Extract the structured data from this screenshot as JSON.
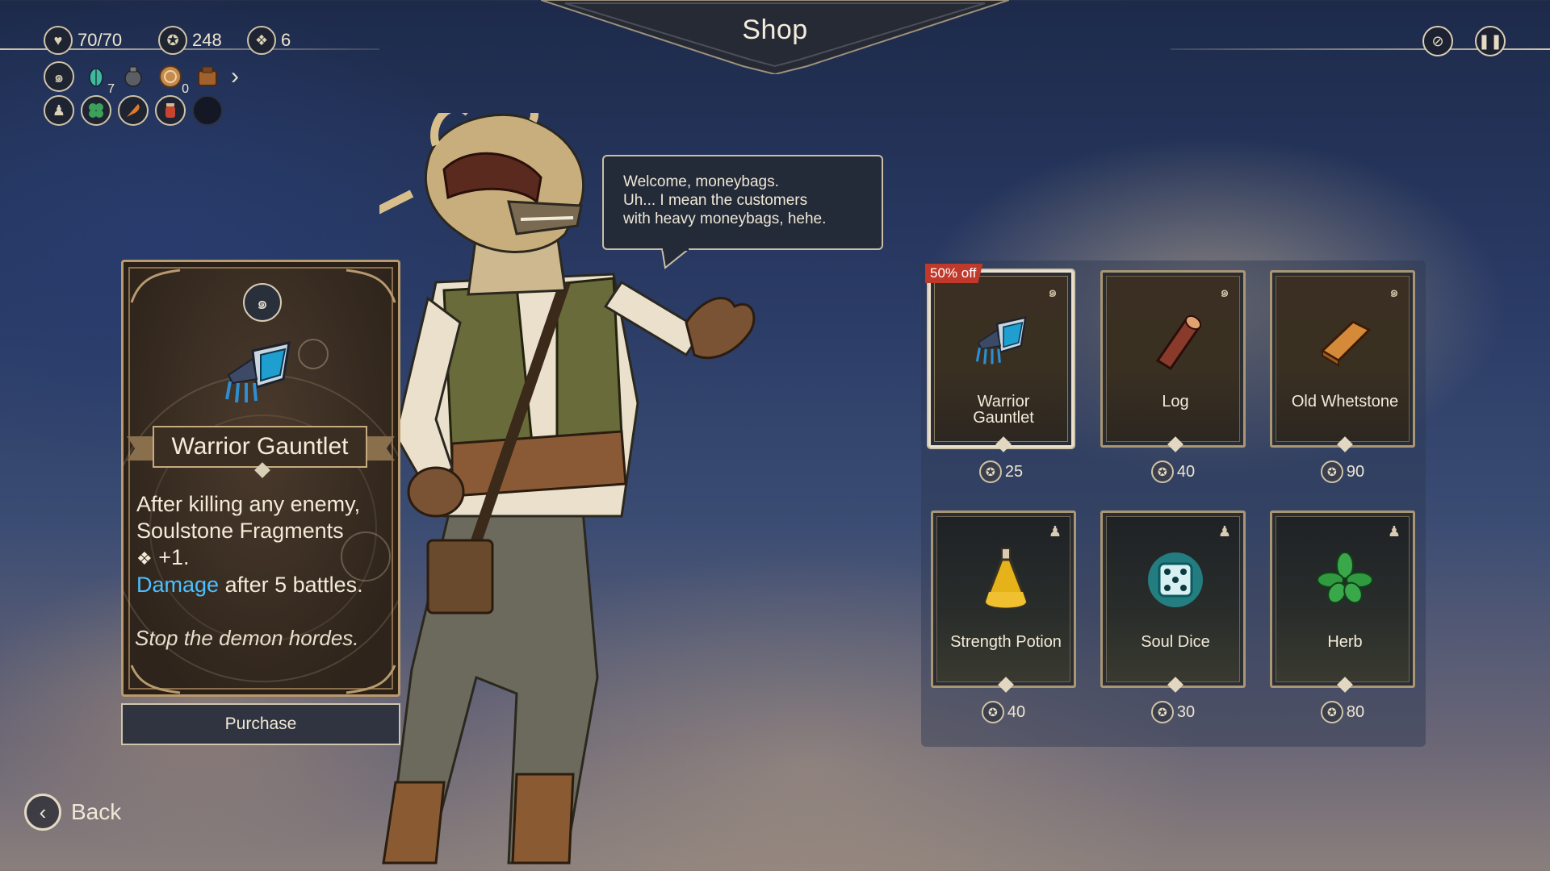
{
  "hud": {
    "health": "70/70",
    "coins": "248",
    "soulstones": "6",
    "relics": [
      {
        "icon": "spiral-icon",
        "count": ""
      },
      {
        "icon": "beetle-icon",
        "count": "7"
      },
      {
        "icon": "lantern-icon",
        "count": ""
      },
      {
        "icon": "shell-icon",
        "count": "0"
      },
      {
        "icon": "bag-icon",
        "count": ""
      }
    ],
    "consumables": [
      "sack-icon",
      "clover-icon",
      "feather-icon",
      "jar-icon",
      "empty-slot"
    ]
  },
  "title": "Shop",
  "dialogue": {
    "line1": "Welcome, moneybags.",
    "line2": "Uh... I mean the customers",
    "line3": "with heavy moneybags, hehe."
  },
  "detail": {
    "name": "Warrior Gauntlet",
    "desc_line1": "After killing any enemy,",
    "desc_line2": "Soulstone Fragments",
    "desc_line3": "+1.",
    "desc_keyword": "Damage",
    "desc_line4_rest": " after 5 battles.",
    "flavor": "Stop the demon hordes."
  },
  "purchase_label": "Purchase",
  "back_label": "Back",
  "shop_items": [
    {
      "name": "Warrior Gauntlet",
      "price": "25",
      "tag": "50% off",
      "type": "relic"
    },
    {
      "name": "Log",
      "price": "40",
      "tag": "",
      "type": "relic"
    },
    {
      "name": "Old Whetstone",
      "price": "90",
      "tag": "",
      "type": "relic"
    },
    {
      "name": "Strength Potion",
      "price": "40",
      "tag": "",
      "type": "consumable"
    },
    {
      "name": "Soul Dice",
      "price": "30",
      "tag": "",
      "type": "consumable"
    },
    {
      "name": "Herb",
      "price": "80",
      "tag": "",
      "type": "consumable"
    }
  ],
  "colors": {
    "keyword": "#4bc0ff",
    "sale": "#c0392b",
    "card_border": "#a99673"
  }
}
